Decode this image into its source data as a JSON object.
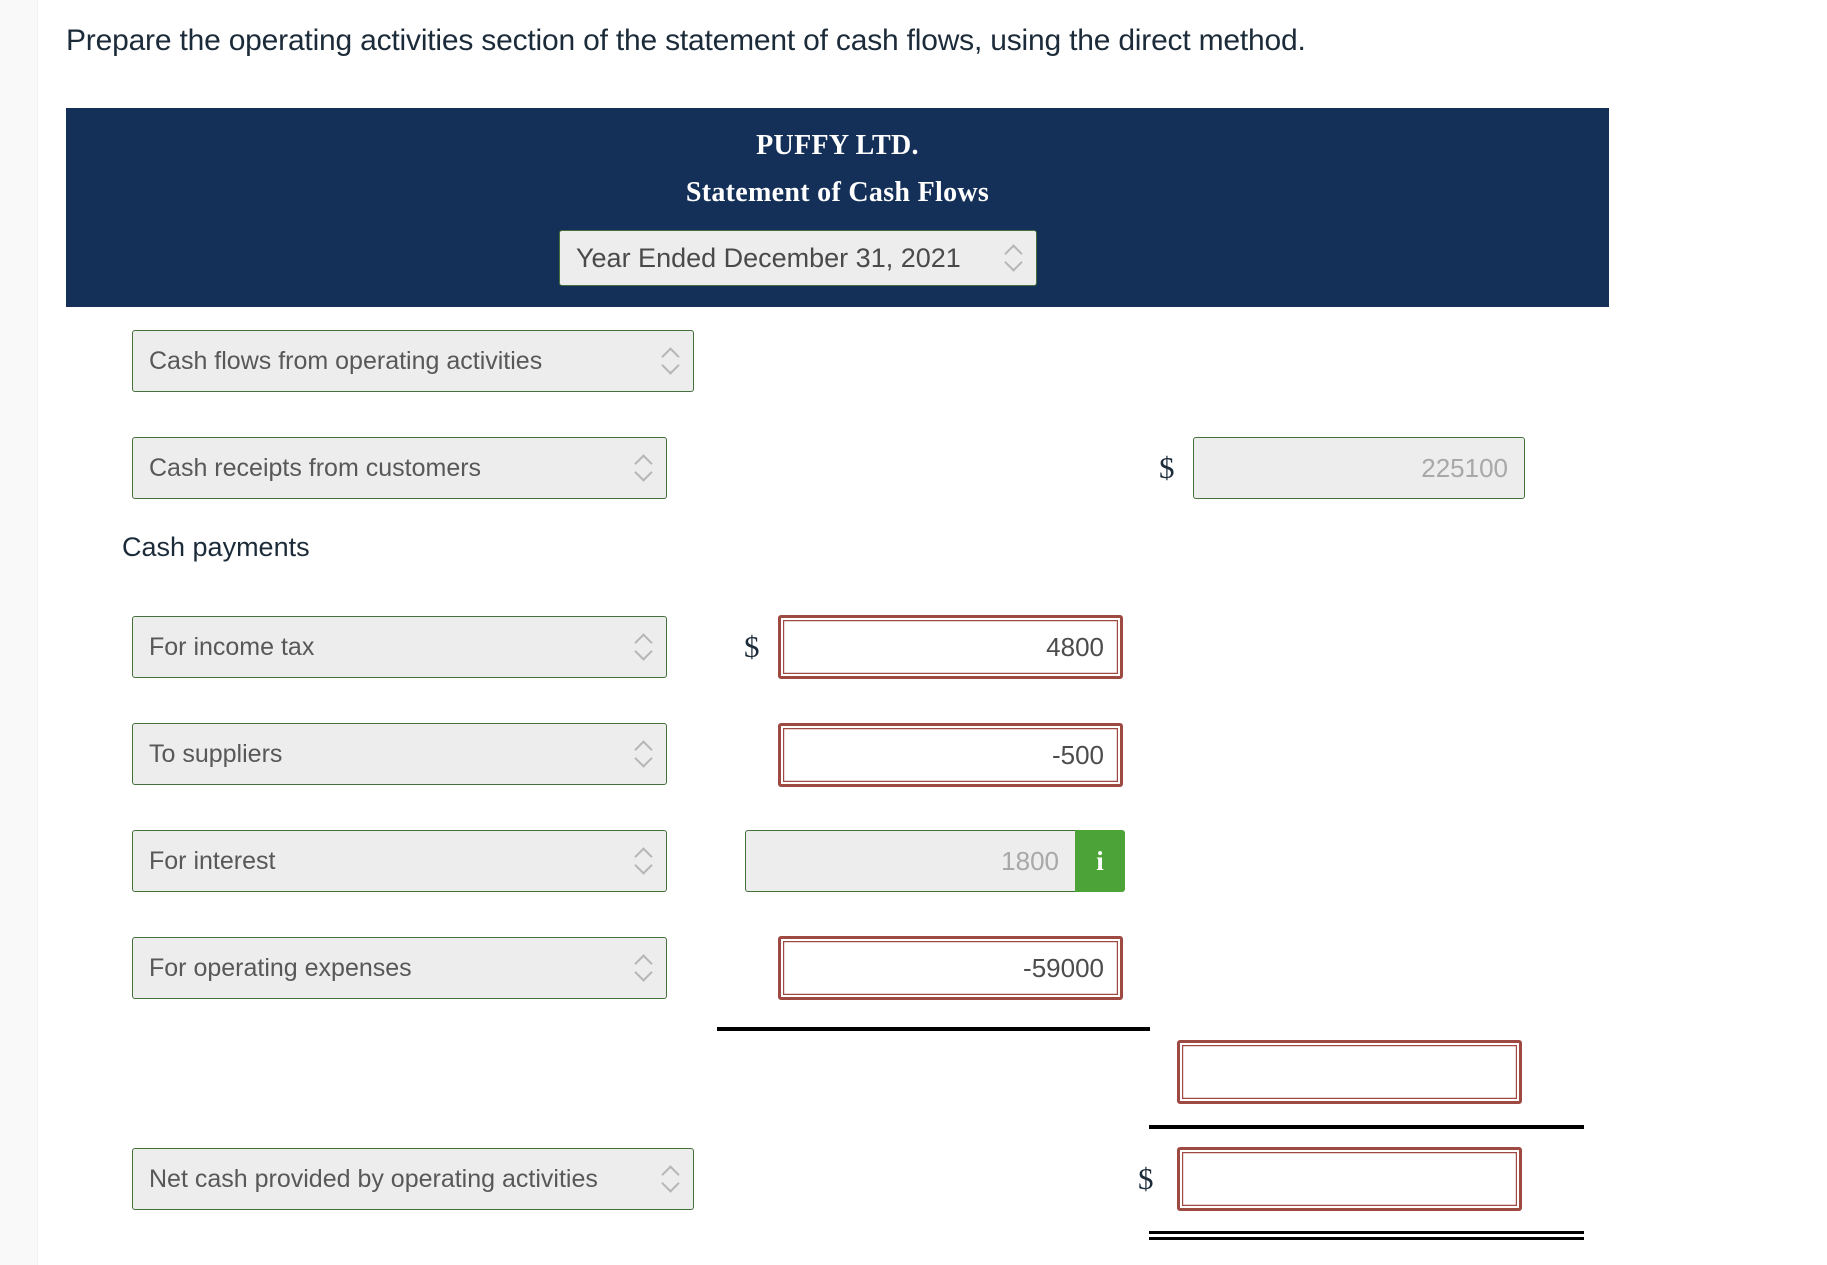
{
  "instruction": "Prepare the operating activities section of the statement of cash flows, using the direct method.",
  "statement_header": {
    "company": "PUFFY LTD.",
    "title": "Statement of Cash Flows",
    "period_select": "Year Ended December 31, 2021"
  },
  "section_heading_select": "Cash flows from operating activities",
  "rows": [
    {
      "label": "Cash receipts from customers",
      "dollar": "$",
      "value": "225100",
      "state": "readonly"
    },
    {
      "label": "For income tax",
      "dollar": "$",
      "value": "4800",
      "state": "error"
    },
    {
      "label": "To suppliers",
      "dollar": "",
      "value": "-500",
      "state": "error"
    },
    {
      "label": "For interest",
      "dollar": "",
      "value": "1800",
      "state": "readonly",
      "info_icon": "i"
    },
    {
      "label": "For operating expenses",
      "dollar": "",
      "value": "-59000",
      "state": "error"
    }
  ],
  "cash_payments_heading": "Cash payments",
  "subtotal": {
    "value": "",
    "state": "error"
  },
  "net_cash": {
    "label": "Net cash provided by operating activities",
    "dollar": "$",
    "value": "",
    "state": "error"
  },
  "colors": {
    "header_navy": "#143059",
    "select_border_green": "#44703c",
    "input_error_red": "#9e4a43",
    "info_button_green": "#4ca337",
    "readonly_fill": "#ededed"
  }
}
